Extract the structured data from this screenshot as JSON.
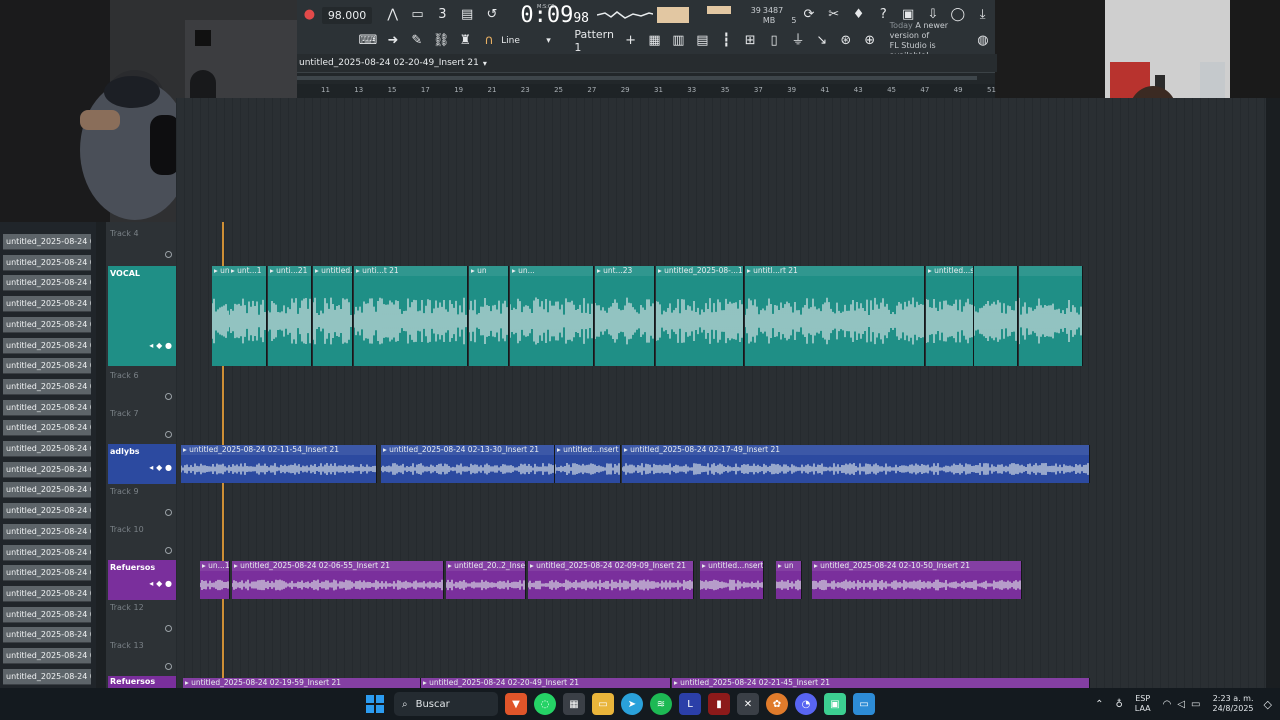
{
  "toolbar": {
    "tempo": "98.000",
    "time_main": "0:09",
    "time_sub": "98",
    "time_label": "M:S:CS",
    "cpu_value": "39",
    "mem_value": "3487 MB",
    "poly_value": "5",
    "snap_mode": "Line",
    "pattern": "Pattern 1",
    "notice_day": "Today",
    "notice_text_1": "A newer version of",
    "notice_text_2": "FL Studio is available!"
  },
  "playlist": {
    "title": "untitled_2025-08-24 02-20-49_Insert 21",
    "ruler": [
      "11",
      "13",
      "15",
      "17",
      "19",
      "21",
      "23",
      "25",
      "27",
      "29",
      "31",
      "33",
      "35",
      "37",
      "39",
      "41",
      "43",
      "45",
      "47",
      "49",
      "51"
    ]
  },
  "picker": {
    "items": [
      "untitled_2025-08-24 01-...",
      "untitled_2025-08-24 01-...",
      "untitled_2025-08-24 01-...",
      "untitled_2025-08-24 01-...",
      "untitled_2025-08-24 01-...",
      "untitled_2025-08-24 01-...",
      "untitled_2025-08-24 01-...",
      "untitled_2025-08-24 01-...",
      "untitled_2025-08-24 01-...",
      "untitled_2025-08-24 01-...",
      "untitled_2025-08-24 01-...",
      "untitled_2025-08-24 02-...",
      "untitled_2025-08-24 02-...",
      "untitled_2025-08-24 02-...",
      "untitled_2025-08-24 02-...",
      "untitled_2025-08-24 02-...",
      "untitled_2025-08-24 02-...",
      "untitled_2025-08-24 02-...",
      "untitled_2025-08-24 02-...",
      "untitled_2025-08-24 02-...",
      "untitled_2025-08-24 02-...",
      "untitled_2025-08-24 02-...",
      "untitled_2025-08-24 02-..."
    ]
  },
  "tracks": {
    "t4": "Track 4",
    "vocal": "VOCAL",
    "t6": "Track 6",
    "t7": "Track 7",
    "adlybs": "adlybs",
    "t9": "Track 9",
    "t10": "Track 10",
    "refuersos": "Refuersos",
    "t12": "Track 12",
    "t13": "Track 13",
    "refuersos2": "Refuersos"
  },
  "clips": {
    "vocal": [
      "▸ unt..21",
      "▸ unt...1",
      "▸ unti...21",
      "▸ untitled...nsert 21",
      "▸ unti...t 21",
      "▸ un",
      "▸ un...",
      "▸ unt...23",
      "▸ untitled_2025-08-...1-40-38_Insert 21",
      "▸ untitl...rt 21",
      "▸ untitled...sert 21"
    ],
    "adlybs": [
      "▸ untitled_2025-08-24 02-11-54_Insert 21",
      "▸ untitled_2025-08-24 02-13-30_Insert 21",
      "▸ untitled...nsert 21",
      "▸ untitled_2025-08-24 02-17-49_Insert 21"
    ],
    "refuersos": [
      "▸ un...1",
      "▸ untitled_2025-08-24 02-06-55_Insert 21",
      "▸ untitled_20..2_Insert 21",
      "▸ untitled_2025-08-24 02-09-09_Insert 21",
      "▸ untitled...nsert 21",
      "▸ un",
      "▸ untitled_2025-08-24 02-10-50_Insert 21"
    ],
    "refuersos2": [
      "▸ untitled_2025-08-24 02-19-59_Insert 21",
      "▸ untitled_2025-08-24 02-20-49_Insert 21",
      "▸ untitled_2025-08-24 02-21-45_Insert 21"
    ]
  },
  "taskbar": {
    "search": "Buscar",
    "lang_1": "ESP",
    "lang_2": "LAA",
    "time": "2:23 a. m.",
    "date": "24/8/2025"
  },
  "colors": {
    "vocal": "#1f8f86",
    "adlybs": "#2c4aa0",
    "refuersos": "#7a2f9c",
    "playhead": "#e09a36"
  }
}
